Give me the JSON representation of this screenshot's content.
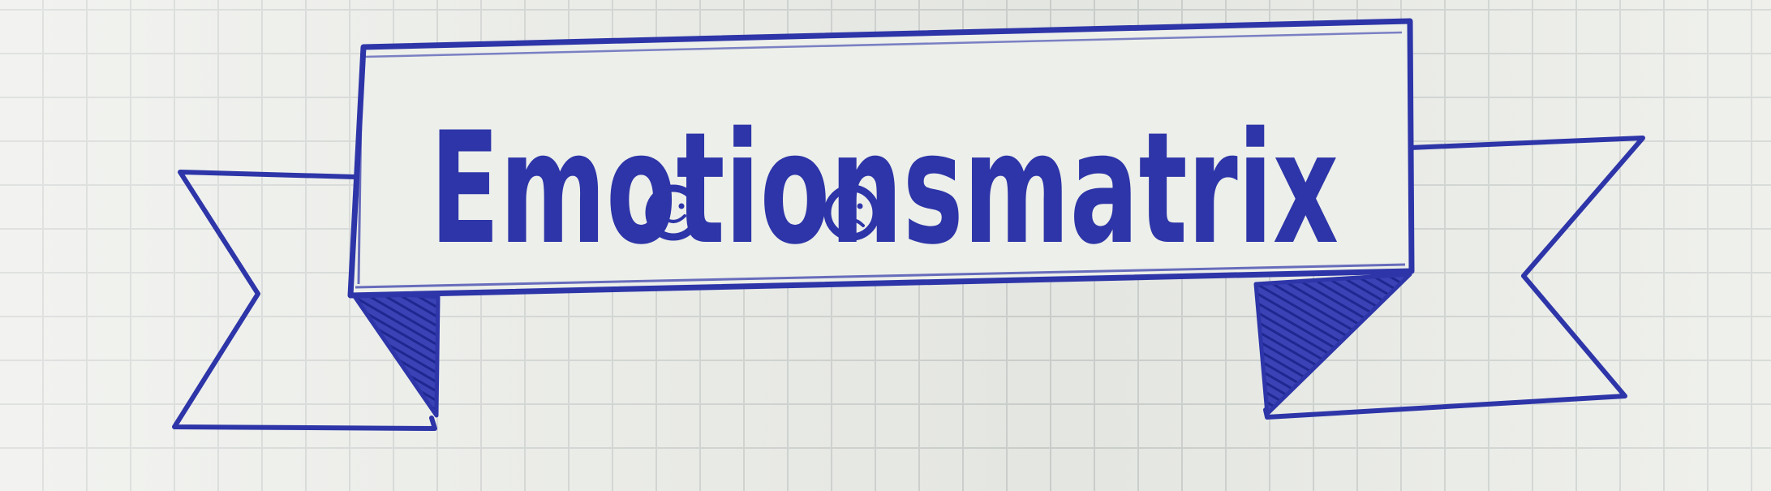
{
  "banner": {
    "text": "Emotionsmatrix",
    "ink_color": "#2d35a8",
    "paper_color": "#ebede8",
    "grid_color": "#cfd3d0"
  },
  "icons": {
    "happy_face": "smiling-face-icon",
    "sad_face": "frowning-face-icon"
  }
}
